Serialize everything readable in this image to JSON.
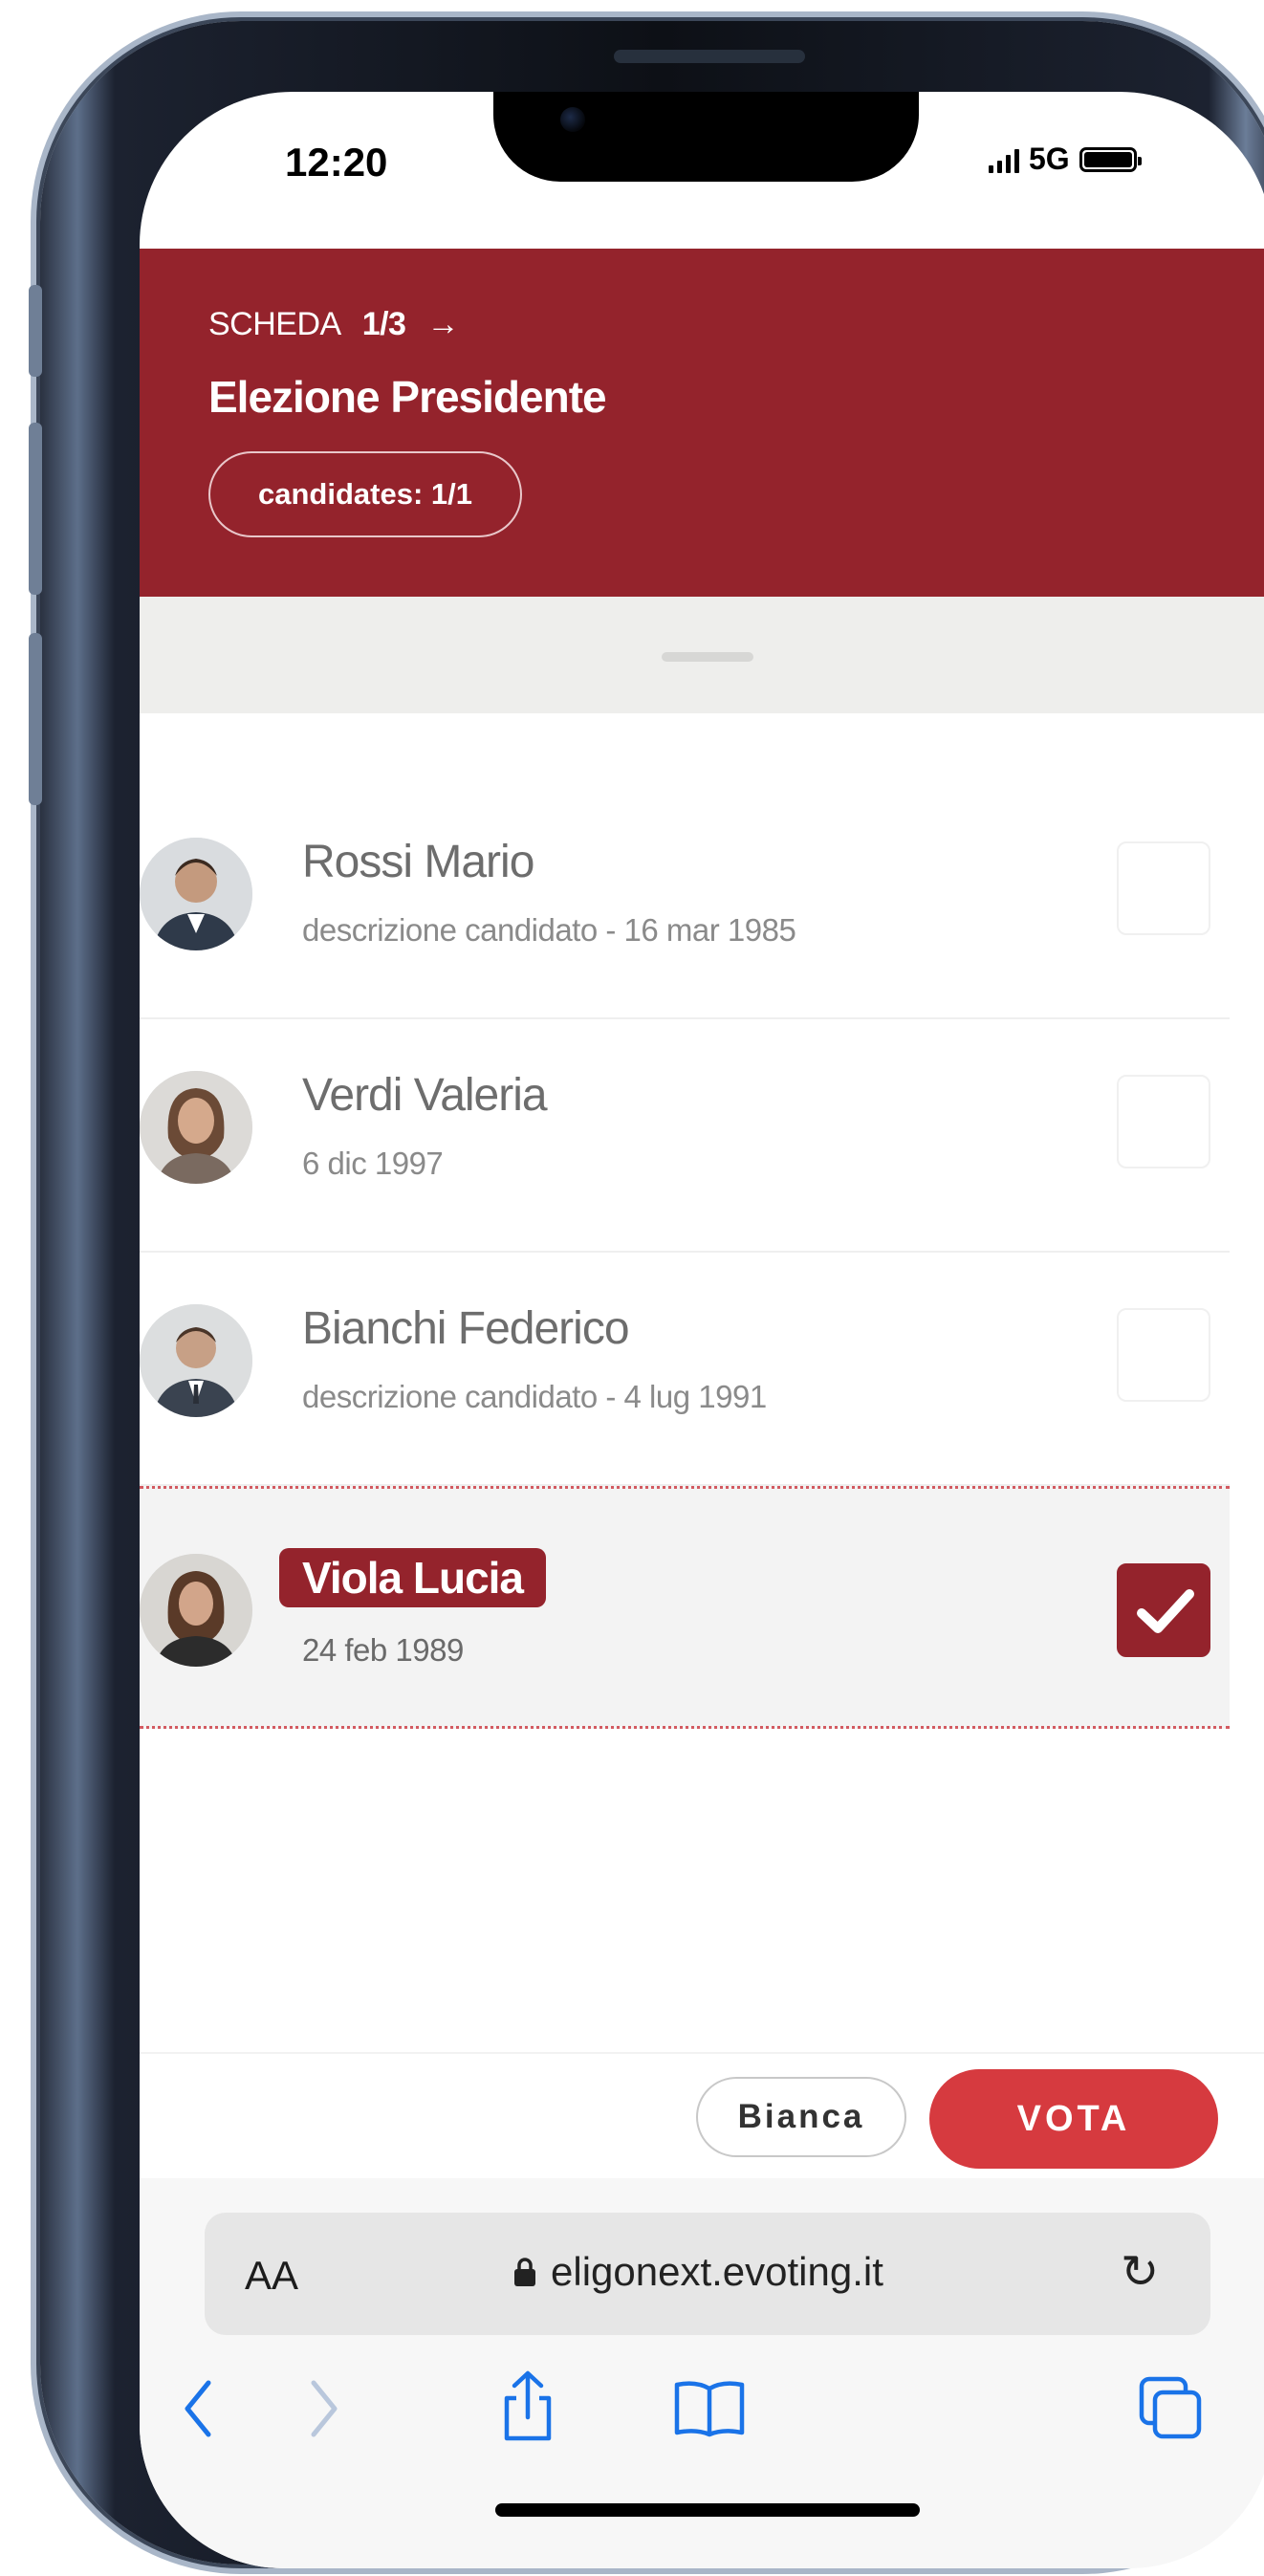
{
  "status_bar": {
    "time": "12:20",
    "network": "5G",
    "battery_level": 1.0
  },
  "header": {
    "section_label": "SCHEDA",
    "page_indicator": "1/3",
    "arrow": "→",
    "title": "Elezione Presidente",
    "candidates_pill": "candidates: 1/1",
    "background_color": "#94232c"
  },
  "candidates": [
    {
      "name": "Rossi Mario",
      "description": "descrizione candidato - 16 mar 1985",
      "selected": false,
      "avatar_icon": "male-portrait-icon"
    },
    {
      "name": "Verdi Valeria",
      "description": "6 dic 1997",
      "selected": false,
      "avatar_icon": "female-portrait-icon"
    },
    {
      "name": "Bianchi Federico",
      "description": "descrizione candidato - 4 lug 1991",
      "selected": false,
      "avatar_icon": "male-portrait-icon"
    },
    {
      "name": "Viola Lucia",
      "description": "24 feb 1989",
      "selected": true,
      "avatar_icon": "female-portrait-icon"
    }
  ],
  "actions": {
    "blank_label": "Bianca",
    "vote_label": "VOTA",
    "vote_color": "#d63a3f"
  },
  "browser": {
    "text_size_label": "AA",
    "url": "eligonext.evoting.it",
    "toolbar_icons": [
      "back-icon",
      "forward-icon",
      "share-icon",
      "bookmarks-icon",
      "tabs-icon"
    ]
  }
}
